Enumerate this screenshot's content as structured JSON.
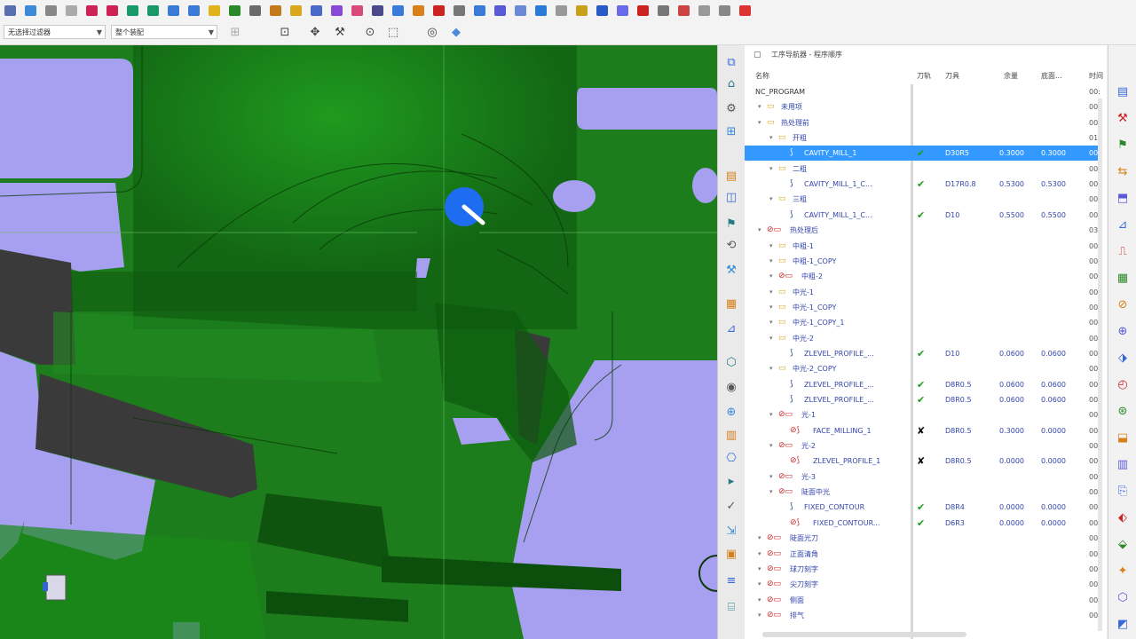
{
  "toolbar_top": {
    "icons": [
      "grid-icon",
      "layout-icon",
      "wrench-icon",
      "doc-icon",
      "arrow-left-icon",
      "arrow-right-icon",
      "arrow-up-icon",
      "arrow-down-icon",
      "layer-icon",
      "layer2-icon",
      "folder-icon",
      "box-icon",
      "nav-icon",
      "hand-icon",
      "info-icon",
      "cube-icon",
      "cube2-icon",
      "sync-icon",
      "chain-icon",
      "paint-icon",
      "tool-icon",
      "flag-icon",
      "gear-icon",
      "list-icon",
      "grid2-icon",
      "table-icon",
      "measure-icon",
      "circle-icon",
      "ruler-icon",
      "shield-icon",
      "wave-icon",
      "stop-icon",
      "clock-icon",
      "link-icon",
      "circle2-icon",
      "clip-icon",
      "close-icon"
    ]
  },
  "toolbar_second": {
    "filter_select": "无选择过滤器",
    "assembly_select": "整个装配",
    "icons": [
      "snap-icon",
      "dot-icon",
      "wrench2-icon",
      "circle-dot-icon",
      "rectangle-icon",
      "view-cube-icon",
      "shaded-cube-icon"
    ]
  },
  "navigator": {
    "title": "工序导航器 - 程序顺序",
    "columns": {
      "name": "名称",
      "toolpath": "刀轨",
      "tool": "刀具",
      "stock": "余量",
      "floor": "底面...",
      "time": "时间"
    },
    "rows": [
      {
        "name": "NC_PROGRAM",
        "level": 0,
        "icon": "none",
        "check": "",
        "tool": "",
        "stock": "",
        "floor": "",
        "time": "00:"
      },
      {
        "name": "未用项",
        "level": 1,
        "icon": "folder-icon",
        "check": "",
        "tool": "",
        "stock": "",
        "floor": "",
        "time": "00:"
      },
      {
        "name": "热处理前",
        "level": 1,
        "icon": "folder-icon",
        "check": "",
        "tool": "",
        "stock": "",
        "floor": "",
        "time": "00:"
      },
      {
        "name": "开粗",
        "level": 2,
        "icon": "folder-icon",
        "check": "",
        "tool": "",
        "stock": "",
        "floor": "",
        "time": "01:"
      },
      {
        "name": "CAVITY_MILL_1",
        "level": 3,
        "icon": "op-icon",
        "check": "ok",
        "tool": "D30R5",
        "stock": "0.3000",
        "floor": "0.3000",
        "time": "00:",
        "selected": true
      },
      {
        "name": "二粗",
        "level": 2,
        "icon": "folder-icon",
        "check": "",
        "tool": "",
        "stock": "",
        "floor": "",
        "time": "00:"
      },
      {
        "name": "CAVITY_MILL_1_C...",
        "level": 3,
        "icon": "op-icon",
        "check": "ok",
        "tool": "D17R0.8",
        "stock": "0.5300",
        "floor": "0.5300",
        "time": "00:"
      },
      {
        "name": "三粗",
        "level": 2,
        "icon": "folder-icon",
        "check": "",
        "tool": "",
        "stock": "",
        "floor": "",
        "time": "00:"
      },
      {
        "name": "CAVITY_MILL_1_C...",
        "level": 3,
        "icon": "op-icon",
        "check": "ok",
        "tool": "D10",
        "stock": "0.5500",
        "floor": "0.5500",
        "time": "00:"
      },
      {
        "name": "热处理后",
        "level": 1,
        "icon": "folder-x-icon",
        "check": "",
        "tool": "",
        "stock": "",
        "floor": "",
        "time": "03:"
      },
      {
        "name": "中粗-1",
        "level": 2,
        "icon": "folder-icon",
        "check": "",
        "tool": "",
        "stock": "",
        "floor": "",
        "time": "00:"
      },
      {
        "name": "中粗-1_COPY",
        "level": 2,
        "icon": "folder-icon",
        "check": "",
        "tool": "",
        "stock": "",
        "floor": "",
        "time": "00:"
      },
      {
        "name": "中粗-2",
        "level": 2,
        "icon": "folder-x-icon",
        "check": "",
        "tool": "",
        "stock": "",
        "floor": "",
        "time": "00:"
      },
      {
        "name": "中光-1",
        "level": 2,
        "icon": "folder-icon",
        "check": "",
        "tool": "",
        "stock": "",
        "floor": "",
        "time": "00:"
      },
      {
        "name": "中光-1_COPY",
        "level": 2,
        "icon": "folder-icon",
        "check": "",
        "tool": "",
        "stock": "",
        "floor": "",
        "time": "00:"
      },
      {
        "name": "中光-1_COPY_1",
        "level": 2,
        "icon": "folder-icon",
        "check": "",
        "tool": "",
        "stock": "",
        "floor": "",
        "time": "00:"
      },
      {
        "name": "中光-2",
        "level": 2,
        "icon": "folder-icon",
        "check": "",
        "tool": "",
        "stock": "",
        "floor": "",
        "time": "00:"
      },
      {
        "name": "ZLEVEL_PROFILE_...",
        "level": 3,
        "icon": "op-icon",
        "check": "ok",
        "tool": "D10",
        "stock": "0.0600",
        "floor": "0.0600",
        "time": "00:"
      },
      {
        "name": "中光-2_COPY",
        "level": 2,
        "icon": "folder-icon",
        "check": "",
        "tool": "",
        "stock": "",
        "floor": "",
        "time": "00:"
      },
      {
        "name": "ZLEVEL_PROFILE_...",
        "level": 3,
        "icon": "op-icon",
        "check": "ok",
        "tool": "D8R0.5",
        "stock": "0.0600",
        "floor": "0.0600",
        "time": "00:"
      },
      {
        "name": "ZLEVEL_PROFILE_...",
        "level": 3,
        "icon": "op-icon",
        "check": "ok",
        "tool": "D8R0.5",
        "stock": "0.0600",
        "floor": "0.0600",
        "time": "00:"
      },
      {
        "name": "光-1",
        "level": 2,
        "icon": "folder-x-icon",
        "check": "",
        "tool": "",
        "stock": "",
        "floor": "",
        "time": "00:"
      },
      {
        "name": "FACE_MILLING_1",
        "level": 3,
        "icon": "op-x-icon",
        "check": "bad",
        "tool": "D8R0.5",
        "stock": "0.3000",
        "floor": "0.0000",
        "time": "00:"
      },
      {
        "name": "光-2",
        "level": 2,
        "icon": "folder-x-icon",
        "check": "",
        "tool": "",
        "stock": "",
        "floor": "",
        "time": "00:"
      },
      {
        "name": "ZLEVEL_PROFILE_1",
        "level": 3,
        "icon": "op-x-icon",
        "check": "bad",
        "tool": "D8R0.5",
        "stock": "0.0000",
        "floor": "0.0000",
        "time": "00:"
      },
      {
        "name": "光-3",
        "level": 2,
        "icon": "folder-x-icon",
        "check": "",
        "tool": "",
        "stock": "",
        "floor": "",
        "time": "00:"
      },
      {
        "name": "陡面中光",
        "level": 2,
        "icon": "folder-x-icon",
        "check": "",
        "tool": "",
        "stock": "",
        "floor": "",
        "time": "00:"
      },
      {
        "name": "FIXED_CONTOUR",
        "level": 3,
        "icon": "op-icon",
        "check": "ok",
        "tool": "D8R4",
        "stock": "0.0000",
        "floor": "0.0000",
        "time": "00:"
      },
      {
        "name": "FIXED_CONTOUR...",
        "level": 3,
        "icon": "op-x-icon",
        "check": "ok",
        "tool": "D6R3",
        "stock": "0.0000",
        "floor": "0.0000",
        "time": "00:"
      },
      {
        "name": "陡面光刀",
        "level": 1,
        "icon": "folder-x-icon",
        "check": "",
        "tool": "",
        "stock": "",
        "floor": "",
        "time": "00:"
      },
      {
        "name": "正面清角",
        "level": 1,
        "icon": "folder-x-icon",
        "check": "",
        "tool": "",
        "stock": "",
        "floor": "",
        "time": "00:"
      },
      {
        "name": "球刀刻字",
        "level": 1,
        "icon": "folder-x-icon",
        "check": "",
        "tool": "",
        "stock": "",
        "floor": "",
        "time": "00:"
      },
      {
        "name": "尖刀刻字",
        "level": 1,
        "icon": "folder-x-icon",
        "check": "",
        "tool": "",
        "stock": "",
        "floor": "",
        "time": "00:"
      },
      {
        "name": "侧面",
        "level": 1,
        "icon": "folder-x-icon",
        "check": "",
        "tool": "",
        "stock": "",
        "floor": "",
        "time": "00:"
      },
      {
        "name": "排气",
        "level": 1,
        "icon": "folder-x-icon",
        "check": "",
        "tool": "",
        "stock": "",
        "floor": "",
        "time": "00:"
      }
    ]
  },
  "palette_icons": [
    "navigator-icon",
    "program-view-icon",
    "tool-view-icon",
    "geometry-view-icon",
    "method-view-icon",
    "part-icon",
    "assembly-icon",
    "constraint-icon",
    "history-icon",
    "roles-icon",
    "process-icon",
    "machine-icon",
    "hd3d-icon",
    "web-icon",
    "library-icon",
    "template-icon",
    "simulate-icon",
    "verify-icon",
    "post-icon",
    "doc-icon",
    "report-icon",
    "shop-icon"
  ],
  "rightbar_icons": [
    "tb1-icon",
    "tb2-icon",
    "tb3-icon",
    "tb4-icon",
    "tb5-icon",
    "tb6-icon",
    "tb7-icon",
    "tb8-icon",
    "tb9-icon",
    "tb10-icon",
    "tb11-icon",
    "tb12-icon",
    "tb13-icon",
    "tb14-icon",
    "tb15-icon",
    "tb16-icon",
    "tb17-icon",
    "tb18-icon",
    "tb19-icon",
    "tb20-icon",
    "tb21-icon"
  ]
}
